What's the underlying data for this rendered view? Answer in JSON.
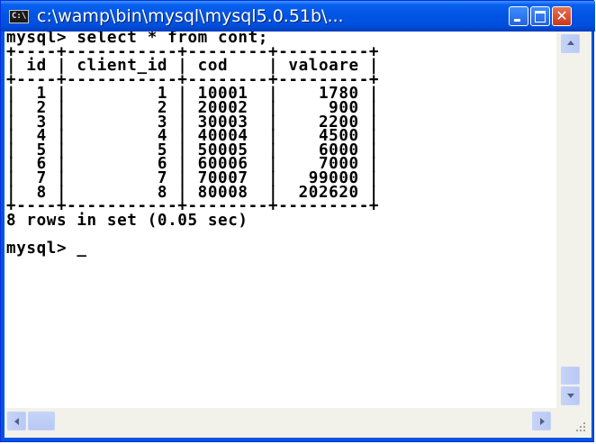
{
  "window": {
    "title": "c:\\wamp\\bin\\mysql\\mysql5.0.51b\\...",
    "icon_label": "C:\\",
    "close_glyph": "✕"
  },
  "console": {
    "lines": [
      "mysql> select * from cont;",
      "+----+-----------+--------+---------+",
      "| id | client_id | cod    | valoare |",
      "+----+-----------+--------+---------+",
      "|  1 |         1 | 10001  |    1780 |",
      "|  2 |         2 | 20002  |     900 |",
      "|  3 |         3 | 30003  |    2200 |",
      "|  4 |         4 | 40004  |    4500 |",
      "|  5 |         5 | 50005  |    6000 |",
      "|  6 |         6 | 60006  |    7000 |",
      "|  7 |         7 | 70007  |   99000 |",
      "|  8 |         8 | 80008  |  202620 |",
      "+----+-----------+--------+---------+",
      "8 rows in set (0.05 sec)",
      "",
      "mysql> _"
    ]
  }
}
